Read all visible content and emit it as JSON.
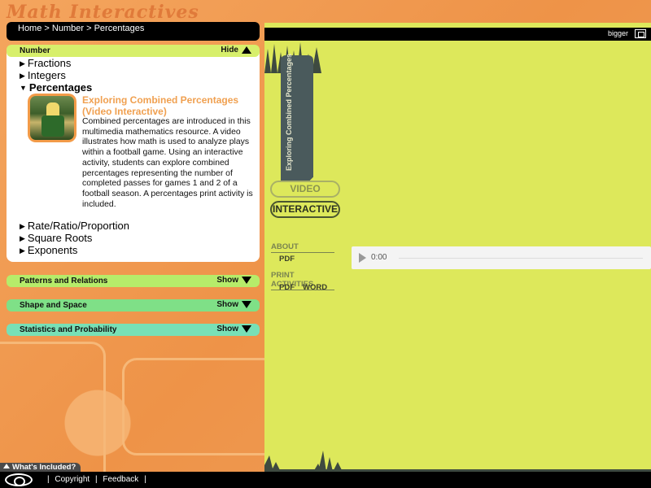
{
  "app": {
    "title": "Math Interactives"
  },
  "breadcrumb": {
    "items": [
      "Home",
      "Number",
      "Percentages"
    ],
    "separator": ">"
  },
  "sections": [
    {
      "label": "Number",
      "toggle_label": "Hide",
      "expanded": true,
      "color": "#d7ef6b"
    },
    {
      "label": "Patterns and Relations",
      "toggle_label": "Show",
      "expanded": false,
      "color": "#b6ec6a"
    },
    {
      "label": "Shape and Space",
      "toggle_label": "Show",
      "expanded": false,
      "color": "#7fe087"
    },
    {
      "label": "Statistics and Probability",
      "toggle_label": "Show",
      "expanded": false,
      "color": "#78e0b6"
    }
  ],
  "number_topics": [
    {
      "label": "Fractions",
      "arrow": "▶"
    },
    {
      "label": "Integers",
      "arrow": "▶"
    },
    {
      "label": "Percentages",
      "arrow": "▼"
    },
    {
      "label": "Rate/Ratio/Proportion",
      "arrow": "▶"
    },
    {
      "label": "Square Roots",
      "arrow": "▶"
    },
    {
      "label": "Exponents",
      "arrow": "▶"
    }
  ],
  "resource": {
    "title": "Exploring Combined Percentages (Video Interactive)",
    "description": "Combined percentages are introduced in this multimedia mathematics resource. A video illustrates how math is used to analyze plays within a football game. Using an interactive activity, students can explore combined percentages representing the number of completed passes for games 1 and 2 of a football season. A percentages print activity is included."
  },
  "content": {
    "bigger_label": "bigger",
    "banner_title": "Exploring Combined Percentages",
    "buttons": {
      "video": "VIDEO",
      "interactive": "INTERACTIVE"
    },
    "about_label": "ABOUT",
    "about_links": [
      "PDF"
    ],
    "print_label": "PRINT ACTIVITIES",
    "print_links": [
      "PDF",
      "WORD"
    ],
    "audio_time": "0:00",
    "background_color": "#dde85b"
  },
  "footer": {
    "whats_included": "What's Included?",
    "links": [
      "Copyright",
      "Feedback"
    ],
    "separator": "|"
  },
  "icons": {
    "hide": "triangle-up-icon",
    "show": "triangle-down-icon",
    "play": "play-icon",
    "bigger": "expand-icon",
    "logo": "brand-logo-icon"
  }
}
